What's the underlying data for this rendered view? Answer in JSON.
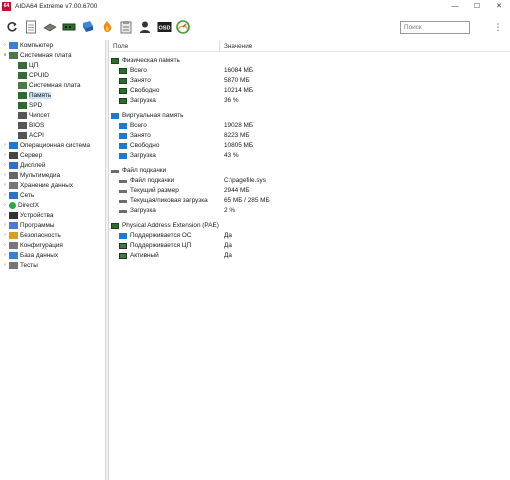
{
  "window": {
    "title": "AIDA64 Extreme v7.00.6700",
    "app_icon_text": "64"
  },
  "toolbar": {
    "search_placeholder": "Поиск",
    "buttons": [
      "refresh-icon",
      "report-icon",
      "motherboard-icon",
      "memory-icon",
      "network-icon",
      "flash-icon",
      "audit-icon",
      "user-icon",
      "osd-icon",
      "benchmark-icon"
    ]
  },
  "tree": {
    "items": [
      {
        "label": "Компьютер",
        "level": 0,
        "chev": ">",
        "icon": "computer-icon"
      },
      {
        "label": "Системная плата",
        "level": 0,
        "chev": "v",
        "icon": "motherboard-icon"
      },
      {
        "label": "ЦП",
        "level": 1,
        "icon": "cpu-icon"
      },
      {
        "label": "CPUID",
        "level": 1,
        "icon": "cpu-icon"
      },
      {
        "label": "Системная плата",
        "level": 1,
        "icon": "motherboard-icon"
      },
      {
        "label": "Память",
        "level": 1,
        "icon": "memory-icon",
        "selected": true
      },
      {
        "label": "SPD",
        "level": 1,
        "icon": "memory-icon"
      },
      {
        "label": "Чипсет",
        "level": 1,
        "icon": "chip-icon"
      },
      {
        "label": "BIOS",
        "level": 1,
        "icon": "chip-icon"
      },
      {
        "label": "ACPI",
        "level": 1,
        "icon": "chip-icon"
      },
      {
        "label": "Операционная система",
        "level": 0,
        "chev": ">",
        "icon": "windows-icon"
      },
      {
        "label": "Сервер",
        "level": 0,
        "chev": ">",
        "icon": "server-icon"
      },
      {
        "label": "Дисплей",
        "level": 0,
        "chev": ">",
        "icon": "display-icon"
      },
      {
        "label": "Мультимедиа",
        "level": 0,
        "chev": ">",
        "icon": "multimedia-icon"
      },
      {
        "label": "Хранение данных",
        "level": 0,
        "chev": ">",
        "icon": "storage-icon"
      },
      {
        "label": "Сеть",
        "level": 0,
        "chev": ">",
        "icon": "network-icon"
      },
      {
        "label": "DirectX",
        "level": 0,
        "chev": ">",
        "icon": "directx-icon"
      },
      {
        "label": "Устройства",
        "level": 0,
        "chev": ">",
        "icon": "devices-icon"
      },
      {
        "label": "Программы",
        "level": 0,
        "chev": ">",
        "icon": "programs-icon"
      },
      {
        "label": "Безопасность",
        "level": 0,
        "chev": ">",
        "icon": "security-icon"
      },
      {
        "label": "Конфигурация",
        "level": 0,
        "chev": ">",
        "icon": "config-icon"
      },
      {
        "label": "База данных",
        "level": 0,
        "chev": ">",
        "icon": "database-icon"
      },
      {
        "label": "Тесты",
        "level": 0,
        "chev": ">",
        "icon": "tests-icon"
      }
    ]
  },
  "columns": {
    "field": "Поле",
    "value": "Значение"
  },
  "rows": [
    {
      "kind": "section",
      "icon": "ram",
      "field": "Физическая память",
      "value": ""
    },
    {
      "kind": "item",
      "icon": "ram",
      "field": "Всего",
      "value": "16084 МБ"
    },
    {
      "kind": "item",
      "icon": "ram",
      "field": "Занято",
      "value": "5870 МБ"
    },
    {
      "kind": "item",
      "icon": "ram",
      "field": "Свободно",
      "value": "10214 МБ"
    },
    {
      "kind": "item",
      "icon": "ram",
      "field": "Загрузка",
      "value": "36 %"
    },
    {
      "kind": "gap"
    },
    {
      "kind": "section",
      "icon": "win",
      "field": "Виртуальная память",
      "value": ""
    },
    {
      "kind": "item",
      "icon": "win",
      "field": "Всего",
      "value": "19028 МБ"
    },
    {
      "kind": "item",
      "icon": "win",
      "field": "Занято",
      "value": "8223 МБ"
    },
    {
      "kind": "item",
      "icon": "win",
      "field": "Свободно",
      "value": "10805 МБ"
    },
    {
      "kind": "item",
      "icon": "win",
      "field": "Загрузка",
      "value": "43 %"
    },
    {
      "kind": "gap"
    },
    {
      "kind": "section",
      "icon": "drive",
      "field": "Файл подкачки",
      "value": ""
    },
    {
      "kind": "item",
      "icon": "drive",
      "field": "Файл подкачки",
      "value": "C:\\pagefile.sys"
    },
    {
      "kind": "item",
      "icon": "drive",
      "field": "Текущий размер",
      "value": "2944 МБ"
    },
    {
      "kind": "item",
      "icon": "drive",
      "field": "Текущая/пиковая загрузка",
      "value": "65 МБ / 285 МБ"
    },
    {
      "kind": "item",
      "icon": "drive",
      "field": "Загрузка",
      "value": "2 %"
    },
    {
      "kind": "gap"
    },
    {
      "kind": "section",
      "icon": "ram",
      "field": "Physical Address Extension (PAE)",
      "value": ""
    },
    {
      "kind": "item",
      "icon": "win",
      "field": "Поддерживается ОС",
      "value": "Да"
    },
    {
      "kind": "item",
      "icon": "chip",
      "field": "Поддерживается ЦП",
      "value": "Да"
    },
    {
      "kind": "item",
      "icon": "chip",
      "field": "Активный",
      "value": "Да"
    }
  ]
}
